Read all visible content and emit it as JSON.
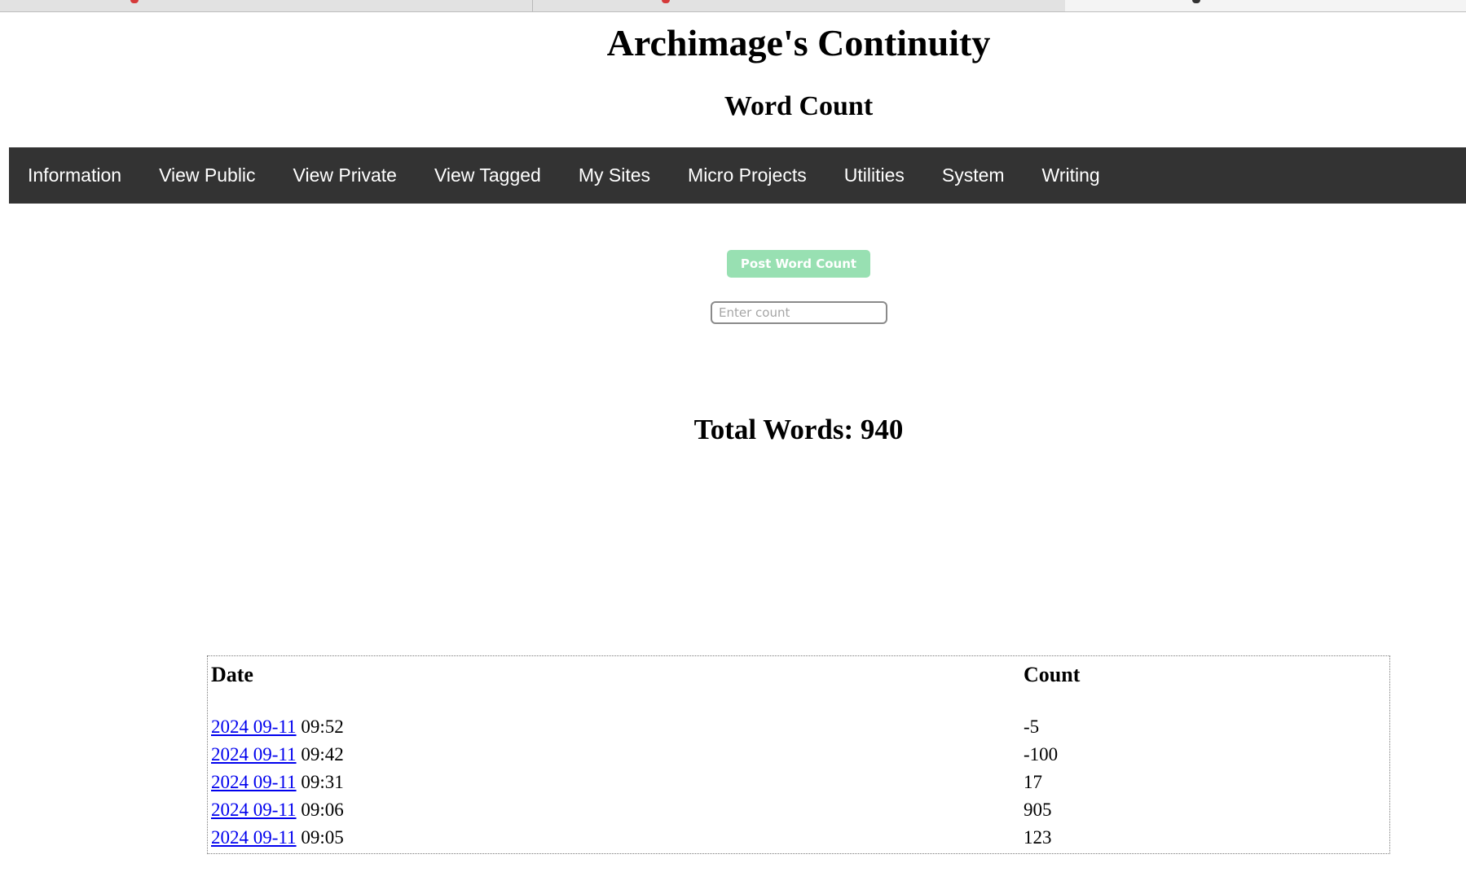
{
  "browser": {
    "tabs": [
      {
        "icon": "red-favicon-icon"
      },
      {
        "icon": "red-favicon-icon"
      },
      {
        "icon": "dark-favicon-icon",
        "active": true
      }
    ]
  },
  "header": {
    "site_title": "Archimage's Continuity",
    "page_title": "Word Count"
  },
  "nav": {
    "items": [
      {
        "label": "Information"
      },
      {
        "label": "View Public"
      },
      {
        "label": "View Private"
      },
      {
        "label": "View Tagged"
      },
      {
        "label": "My Sites"
      },
      {
        "label": "Micro Projects"
      },
      {
        "label": "Utilities"
      },
      {
        "label": "System"
      },
      {
        "label": "Writing"
      }
    ]
  },
  "form": {
    "post_button_label": "Post Word Count",
    "count_input_value": "",
    "count_input_placeholder": "Enter count",
    "button_color": "#98e0b2"
  },
  "summary": {
    "total_label": "Total Words: 940"
  },
  "table": {
    "headers": {
      "date": "Date",
      "count": "Count"
    },
    "rows": [
      {
        "date_link": "2024 09-11",
        "time": "09:52",
        "count": "-5"
      },
      {
        "date_link": "2024 09-11",
        "time": "09:42",
        "count": "-100"
      },
      {
        "date_link": "2024 09-11",
        "time": "09:31",
        "count": "17"
      },
      {
        "date_link": "2024 09-11",
        "time": "09:06",
        "count": "905"
      },
      {
        "date_link": "2024 09-11",
        "time": "09:05",
        "count": "123"
      }
    ]
  }
}
